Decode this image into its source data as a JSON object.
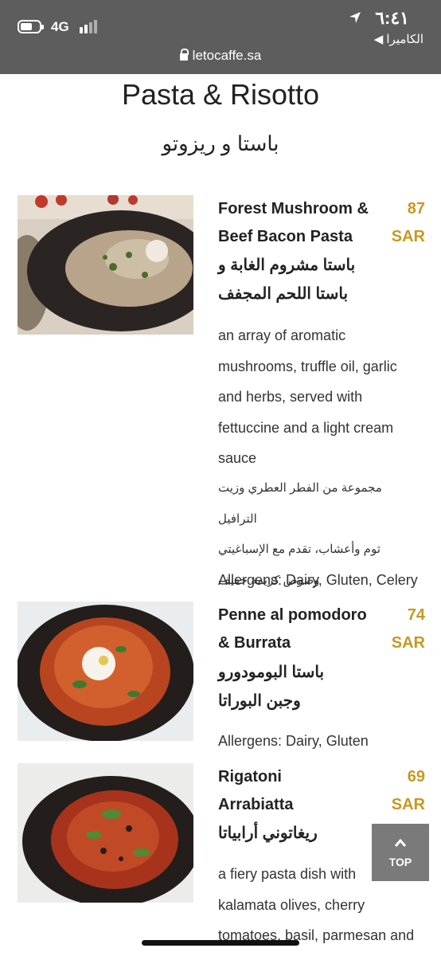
{
  "status": {
    "network": "4G",
    "time": "٦:٤١",
    "back_app": "◀ الكاميرا",
    "url": "letocaffe.sa"
  },
  "section": {
    "title": "Pasta & Risotto",
    "title_ar": "باستا و ريزوتو"
  },
  "dishes": [
    {
      "name_l1": "Forest Mushroom &",
      "name_l2": "Beef Bacon Pasta",
      "name_ar_l1": "باستا مشروم الغابة و",
      "name_ar_l2": "باستا اللحم المجفف",
      "price": "87",
      "currency": "SAR",
      "desc_lines": [
        "an array of aromatic",
        "mushrooms, truffle oil, garlic",
        "and herbs, served with",
        "fettuccine and a light cream",
        "sauce"
      ],
      "desc_ar_lines": [
        "مجموعة من الفطر العطري وزيت الترافيل",
        "ثوم وأعشاب، تقدم مع الإسباغيتي",
        "وصوص كريمة خفيف"
      ],
      "allergens": "Allergens: Dairy, Gluten, Celery"
    },
    {
      "name_l1": "Penne al pomodoro",
      "name_l2": "& Burrata",
      "name_ar_l1": "باستا البومودورو",
      "name_ar_l2": "وجبن البوراتا",
      "price": "74",
      "currency": "SAR",
      "allergens": "Allergens: Dairy, Gluten"
    },
    {
      "name_l1": "Rigatoni",
      "name_l2": "Arrabiatta",
      "name_ar_l1": "ريغاتوني أرابياتا",
      "price": "69",
      "currency": "SAR",
      "desc_lines": [
        "a fiery pasta dish with",
        "kalamata olives, cherry",
        "tomatoes, basil, parmesan and"
      ]
    }
  ],
  "ui": {
    "top_label": "TOP"
  },
  "colors": {
    "price": "#c49a22",
    "status_bar": "#5d5d5d",
    "top_button": "#7a7a7a"
  }
}
